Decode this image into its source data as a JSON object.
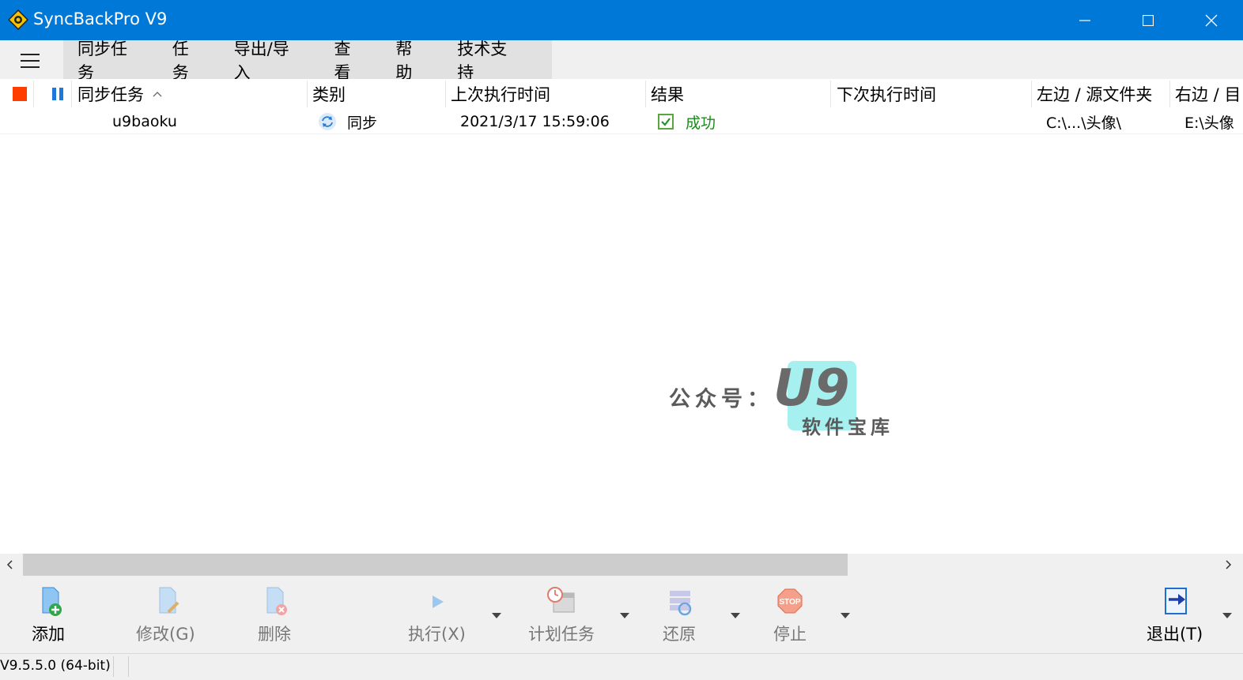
{
  "window": {
    "title": "SyncBackPro V9"
  },
  "menu": {
    "items": [
      "同步任务",
      "任务",
      "导出/导入",
      "查看",
      "帮助",
      "技术支持"
    ]
  },
  "columns": {
    "name": "同步任务",
    "category": "类别",
    "last_run": "上次执行时间",
    "result": "结果",
    "next_run": "下次执行时间",
    "left_source": "左边 / 源文件夹",
    "right_dest": "右边 / 目"
  },
  "rows": [
    {
      "name": "u9baoku",
      "category": "同步",
      "last_run": "2021/3/17 15:59:06",
      "result": "成功",
      "next_run": "",
      "left_source": "C:\\...\\头像\\",
      "right_dest": "E:\\头像"
    }
  ],
  "watermark": {
    "prefix": "公众号：",
    "brand": "U9",
    "sub": "软件宝库"
  },
  "toolbar": {
    "add": "添加",
    "modify": "修改(G)",
    "delete": "删除",
    "run": "执行(X)",
    "schedule": "计划任务",
    "restore": "还原",
    "stop": "停止",
    "exit": "退出(T)"
  },
  "status": {
    "version": "V9.5.5.0 (64-bit)"
  },
  "colors": {
    "titlebar": "#0078d7",
    "success": "#1a8a1a"
  }
}
